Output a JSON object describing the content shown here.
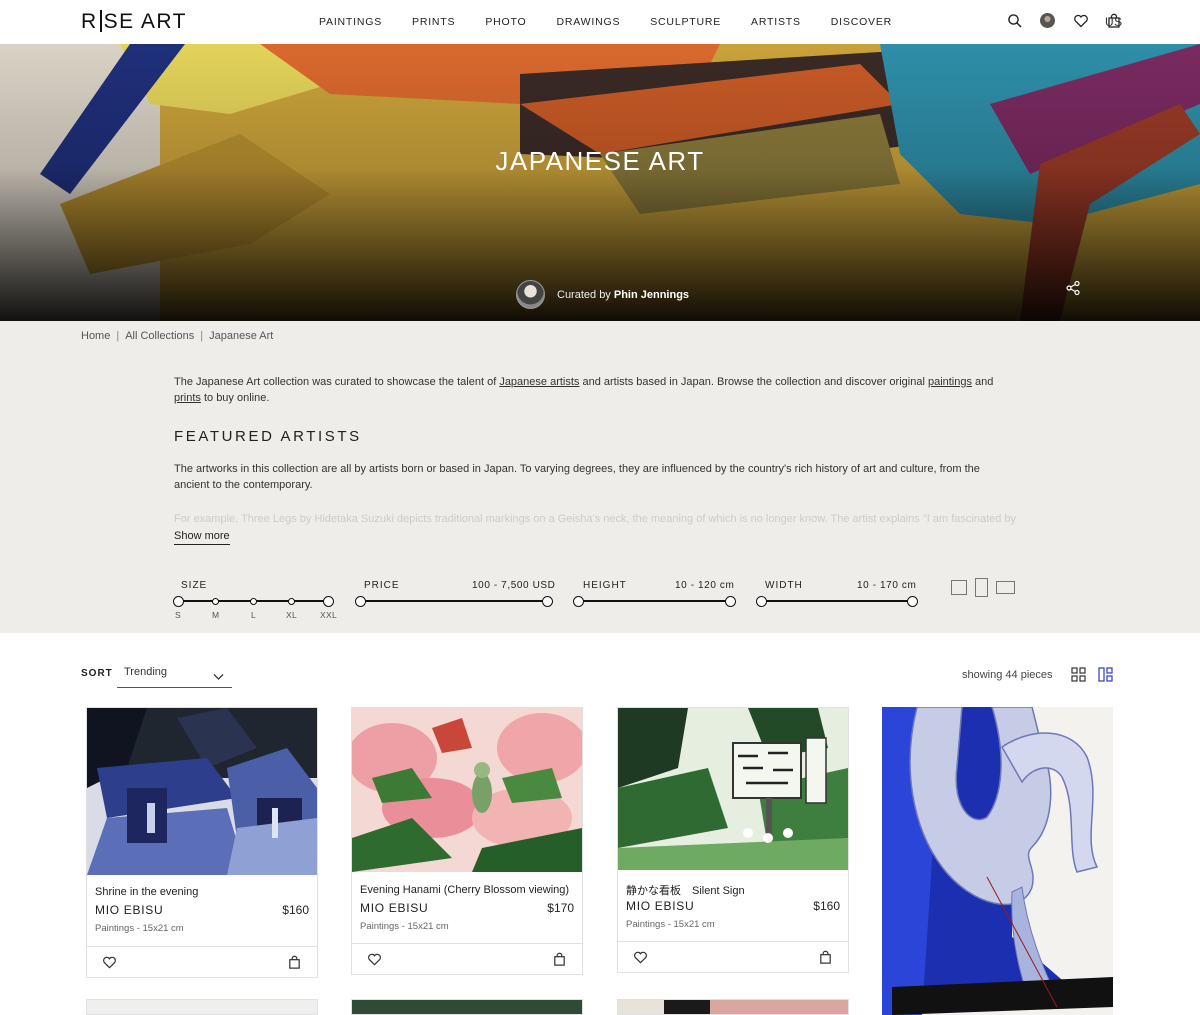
{
  "header": {
    "logo": "R|SE ART",
    "logo_left": "R",
    "logo_right": "SE ART",
    "nav": [
      "PAINTINGS",
      "PRINTS",
      "PHOTO",
      "DRAWINGS",
      "SCULPTURE",
      "ARTISTS",
      "DISCOVER"
    ],
    "locale": "US"
  },
  "hero": {
    "title": "JAPANESE ART",
    "curated_prefix": "Curated by",
    "curator_name": "Phin Jennings"
  },
  "breadcrumb": [
    "Home",
    "All Collections",
    "Japanese Art"
  ],
  "intro": {
    "part1": "The Japanese Art collection was curated to showcase the talent of ",
    "link1": "Japanese artists",
    "part2": " and artists based in Japan. Browse the collection and discover original ",
    "link2": "paintings",
    "part3": " and",
    "link3": "prints",
    "part4": " to buy online."
  },
  "featured": {
    "title": "FEATURED ARTISTS",
    "text": "The artworks in this collection are all by artists born or based in Japan. To varying degrees, they are influenced by the country's rich history of art and culture, from the ancient to the contemporary.",
    "faded": "For example, Three Legs by Hidetaka Suzuki depicts traditional markings on a Geisha's neck, the meaning of which is no longer know. The artist explains \"I am fascinated by",
    "show_more": "Show more"
  },
  "filters": {
    "size_label": "SIZE",
    "size_ticks": [
      "S",
      "M",
      "L",
      "XL",
      "XXL"
    ],
    "price_label": "PRICE",
    "price_range": "100 - 7,500 USD",
    "height_label": "HEIGHT",
    "height_range": "10 - 120 cm",
    "width_label": "WIDTH",
    "width_range": "10 - 170 cm"
  },
  "sort": {
    "label": "SORT",
    "value": "Trending",
    "showing": "showing 44 pieces"
  },
  "cards": [
    {
      "title": "Shrine in the evening",
      "artist": "MIO EBISU",
      "price": "$160",
      "meta": "Paintings - 15x21 cm"
    },
    {
      "title": "Evening Hanami (Cherry Blossom viewing)",
      "artist": "MIO EBISU",
      "price": "$170",
      "meta": "Paintings - 15x21 cm"
    },
    {
      "title": "静かな看板　Silent Sign",
      "artist": "MIO EBISU",
      "price": "$160",
      "meta": "Paintings - 15x21 cm"
    }
  ],
  "colors": {
    "info_bg": "#efedea",
    "text": "#222222",
    "view_active": "#3b44c8"
  }
}
